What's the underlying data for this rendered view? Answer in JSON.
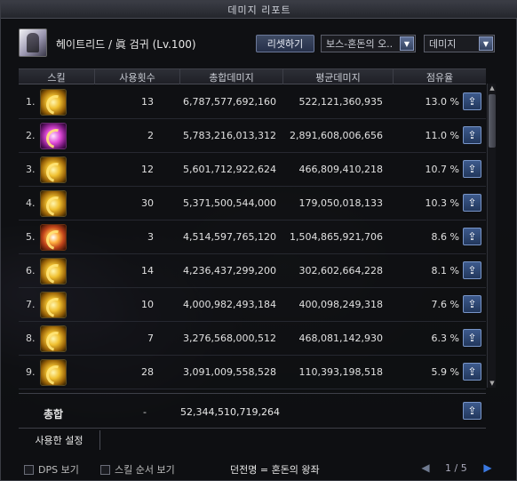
{
  "window": {
    "title": "데미지 리포트"
  },
  "header": {
    "character": "헤이트리드 / 眞 검귀 (Lv.100)",
    "reset_label": "리셋하기",
    "boss_select": "보스-혼돈의 오..",
    "type_select": "데미지"
  },
  "columns": {
    "skill": "스킬",
    "count": "사용횟수",
    "total": "총합데미지",
    "avg": "평균데미지",
    "share": "점유율"
  },
  "rows": [
    {
      "num": "1.",
      "icon": "golden-slash-icon",
      "count": "13",
      "total": "6,787,577,692,160",
      "avg": "522,121,360,935",
      "share": "13.0 %"
    },
    {
      "num": "2.",
      "icon": "purple-blade-icon",
      "count": "2",
      "total": "5,783,216,013,312",
      "avg": "2,891,608,006,656",
      "share": "11.0 %"
    },
    {
      "num": "3.",
      "icon": "golden-slash-icon",
      "count": "12",
      "total": "5,601,712,922,624",
      "avg": "466,809,410,218",
      "share": "10.7 %"
    },
    {
      "num": "4.",
      "icon": "golden-slash-icon",
      "count": "30",
      "total": "5,371,500,544,000",
      "avg": "179,050,018,133",
      "share": "10.3 %"
    },
    {
      "num": "5.",
      "icon": "burst-icon",
      "count": "3",
      "total": "4,514,597,765,120",
      "avg": "1,504,865,921,706",
      "share": "8.6 %"
    },
    {
      "num": "6.",
      "icon": "golden-slash-icon",
      "count": "14",
      "total": "4,236,437,299,200",
      "avg": "302,602,664,228",
      "share": "8.1 %"
    },
    {
      "num": "7.",
      "icon": "golden-slash-icon",
      "count": "10",
      "total": "4,000,982,493,184",
      "avg": "400,098,249,318",
      "share": "7.6 %"
    },
    {
      "num": "8.",
      "icon": "golden-warrior-icon",
      "count": "7",
      "total": "3,276,568,000,512",
      "avg": "468,081,142,930",
      "share": "6.3 %"
    },
    {
      "num": "9.",
      "icon": "golden-slash-icon",
      "count": "28",
      "total": "3,091,009,558,528",
      "avg": "110,393,198,518",
      "share": "5.9 %"
    }
  ],
  "total": {
    "label": "총합",
    "count": "-",
    "total": "52,344,510,719,264"
  },
  "used_setting": "사용한 설정",
  "footer": {
    "dps_label": "DPS 보기",
    "order_label": "스킬 순서 보기",
    "dungeon": "던전명 = 혼돈의 왕좌",
    "page": "1 / 5"
  }
}
